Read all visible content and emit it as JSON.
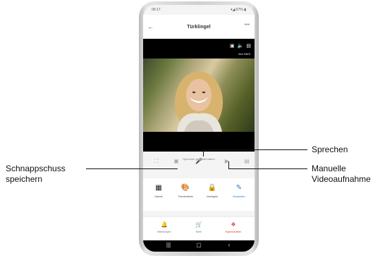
{
  "status": {
    "time": "09:17",
    "indicators": "▾◢ 67% ▮"
  },
  "header": {
    "title": "Türklingel",
    "back_icon": "back-arrow-icon",
    "more_icon": "more-icon"
  },
  "video": {
    "speed": "344 KB/S",
    "tools": [
      "camera-icon",
      "speaker-icon",
      "fullscreen-icon"
    ],
    "overlay": "Sprechen gedrückt halten"
  },
  "controls": [
    "expand-icon",
    "snapshot-icon",
    "microphone-icon",
    "record-icon",
    "storage-icon"
  ],
  "features": [
    {
      "label": "Galerie",
      "icon": "gallery-icon",
      "color": "#1a1a1a"
    },
    {
      "label": "Themenfarbe",
      "icon": "palette-icon",
      "color": "#1a1a1a"
    },
    {
      "label": "Verriegeln",
      "icon": "lock-icon",
      "color": "#1a1a1a"
    },
    {
      "label": "Bearbeiten",
      "icon": "edit-icon",
      "color": "#2f78d6"
    }
  ],
  "bottom_nav": [
    {
      "label": "Mitteilungen",
      "icon": "bell-icon"
    },
    {
      "label": "Mehr",
      "icon": "cart-icon"
    },
    {
      "label": "Eigenschaften",
      "icon": "settings-icon",
      "active": true
    }
  ],
  "system_nav": [
    "recents-icon",
    "home-icon",
    "back-icon"
  ],
  "callouts": {
    "sprechen": "Sprechen",
    "schnappschuss": [
      "Schnappschuss",
      "speichern"
    ],
    "manuelle": [
      "Manuelle",
      "Videoaufnahme"
    ]
  }
}
